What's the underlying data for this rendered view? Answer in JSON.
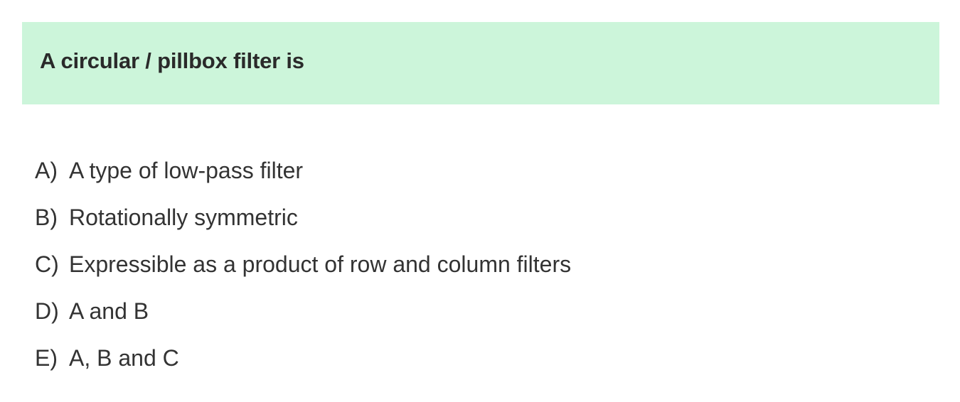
{
  "question": {
    "text": "A circular / pillbox filter is"
  },
  "options": [
    {
      "letter": "A)",
      "text": "A type of low-pass filter"
    },
    {
      "letter": "B)",
      "text": "Rotationally symmetric"
    },
    {
      "letter": "C)",
      "text": "Expressible as a product of row and column filters"
    },
    {
      "letter": "D)",
      "text": "A and B"
    },
    {
      "letter": "E)",
      "text": "A, B and C"
    }
  ],
  "colors": {
    "banner_background": "#ccf5da",
    "text": "#333333"
  }
}
